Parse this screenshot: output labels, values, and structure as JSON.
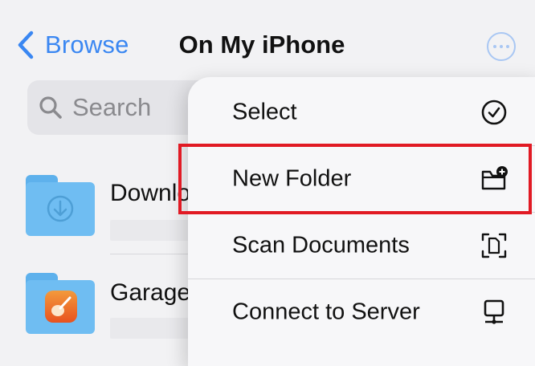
{
  "nav": {
    "back_label": "Browse",
    "title": "On My iPhone",
    "more_icon": "ellipsis-circle-icon"
  },
  "search": {
    "placeholder": "Search"
  },
  "files": [
    {
      "name": "Downloads",
      "visible_name": "Downlo",
      "icon": "download-folder-icon"
    },
    {
      "name": "GarageBand",
      "visible_name": "Garage",
      "icon": "garageband-folder-icon"
    }
  ],
  "menu": {
    "items": [
      {
        "label": "Select",
        "icon": "checkmark-circle-icon"
      },
      {
        "label": "New Folder",
        "icon": "folder-plus-icon"
      },
      {
        "label": "Scan Documents",
        "icon": "doc-scan-icon"
      },
      {
        "label": "Connect to Server",
        "icon": "server-monitor-icon"
      }
    ]
  },
  "colors": {
    "accent": "#3a87f2",
    "highlight": "#e11a24",
    "folder": "#6fbdf2"
  }
}
